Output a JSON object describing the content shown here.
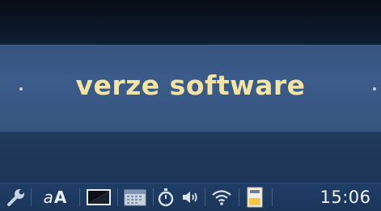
{
  "banner": {
    "title": "verze software"
  },
  "taskbar": {
    "icons": [
      {
        "name": "wrench-icon"
      },
      {
        "name": "font-size-icon",
        "small": "a",
        "big": "A"
      },
      {
        "name": "brightness-icon"
      },
      {
        "name": "calendar-icon"
      },
      {
        "name": "timer-icon"
      },
      {
        "name": "volume-icon"
      },
      {
        "name": "wifi-icon"
      },
      {
        "name": "battery-icon"
      }
    ],
    "clock": "15:06"
  },
  "colors": {
    "title_text": "#f3e3a4",
    "banner_bg": "#3b5b89",
    "taskbar_bg": "#1f3d66"
  }
}
